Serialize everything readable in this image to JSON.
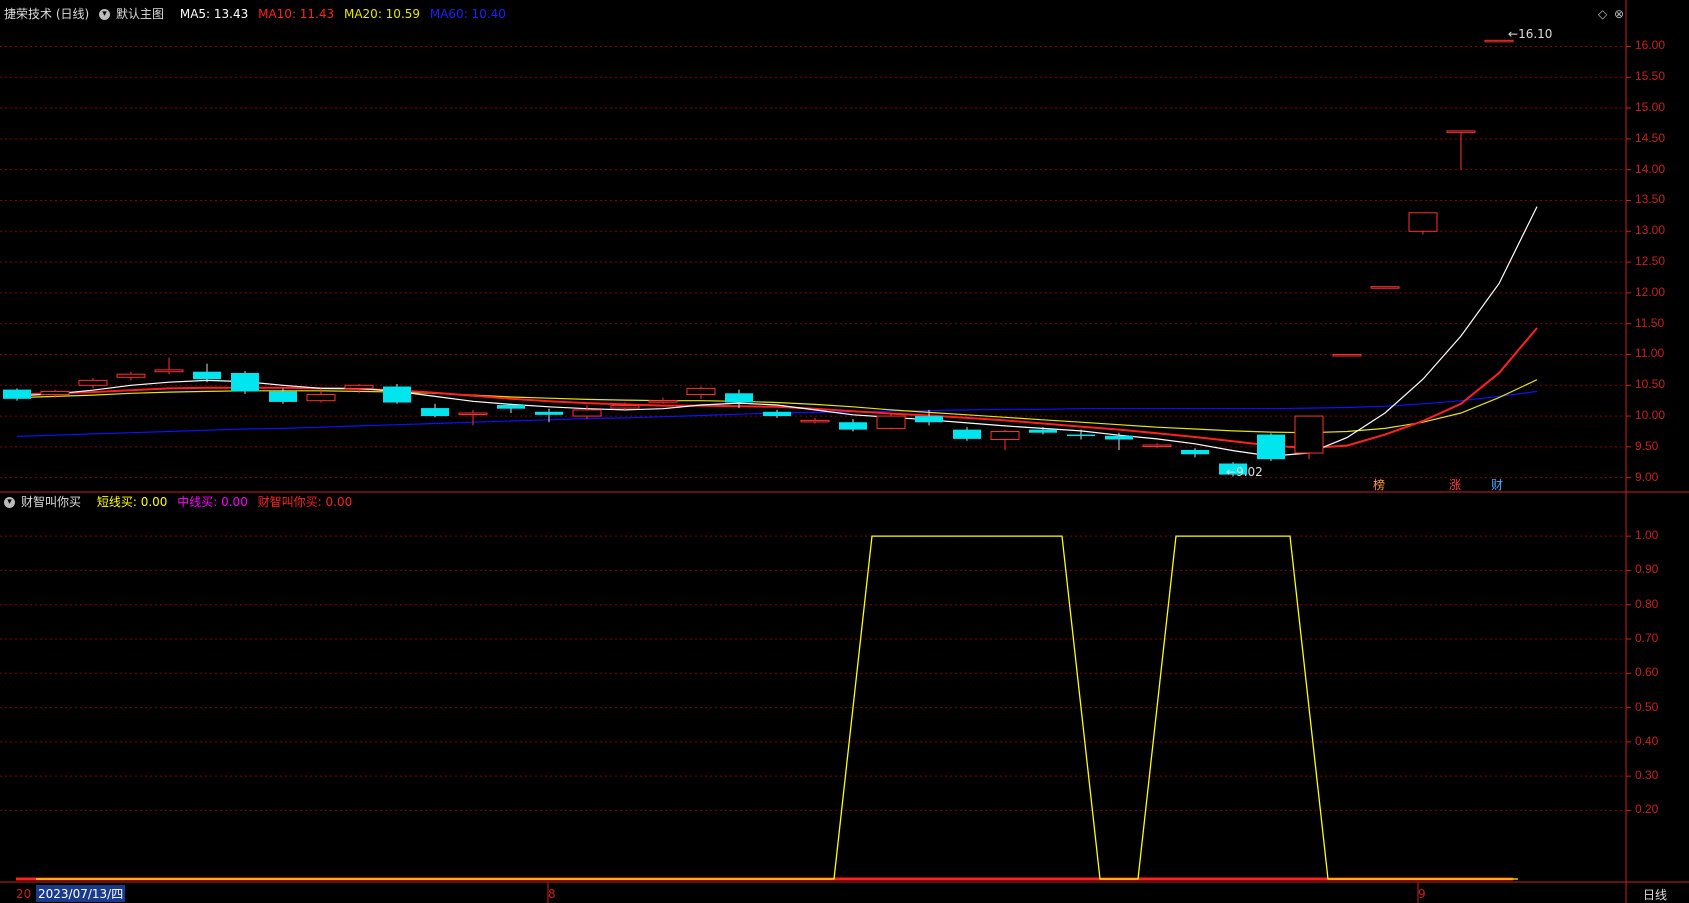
{
  "main_header": {
    "stock_name": "捷荣技术 (日线)",
    "template": "默认主图",
    "ma5": "MA5: 13.43",
    "ma10": "MA10: 11.43",
    "ma20": "MA20: 10.59",
    "ma60": "MA60: 10.40"
  },
  "colors": {
    "bg": "#000000",
    "grid": "#8b0000",
    "axis": "#c8201c",
    "ma5": "#ffffff",
    "ma10": "#ff2020",
    "ma20": "#e6e600",
    "ma60": "#1010ff",
    "up": "#ff3030",
    "down": "#00e5ee",
    "ind_short": "#ffff00",
    "ind_mid": "#ff00ff",
    "ind_call": "#ff2020"
  },
  "price_axis": {
    "ticks": [
      "16.00",
      "15.50",
      "15.00",
      "14.50",
      "14.00",
      "13.50",
      "13.00",
      "12.50",
      "12.00",
      "11.50",
      "11.00",
      "10.50",
      "10.00",
      "9.50",
      "9.00"
    ],
    "high_label": "16.10",
    "low_label": "9.02"
  },
  "indicator_header": {
    "name": "财智叫你买",
    "short_buy": "短线买: 0.00",
    "mid_buy": "中线买: 0.00",
    "call_buy": "财智叫你买: 0.00"
  },
  "indicator_axis": {
    "ticks": [
      "1.00",
      "0.90",
      "0.80",
      "0.70",
      "0.60",
      "0.50",
      "0.40",
      "0.30",
      "0.20"
    ]
  },
  "markers": {
    "cai": "财",
    "bang": "榜",
    "zhang": "涨"
  },
  "time_axis": {
    "left_cut": "20",
    "cursor_date": "2023/07/13/四",
    "month_8": "8",
    "month_9": "9",
    "period_button": "日线"
  },
  "chart_data": {
    "type": "candlestick",
    "title": "捷荣技术 (日线)",
    "ylim": [
      8.8,
      16.3
    ],
    "candles": [
      {
        "o": 10.43,
        "c": 10.28,
        "h": 10.45,
        "l": 10.25
      },
      {
        "o": 10.35,
        "c": 10.4,
        "h": 10.43,
        "l": 10.3
      },
      {
        "o": 10.5,
        "c": 10.58,
        "h": 10.62,
        "l": 10.45
      },
      {
        "o": 10.63,
        "c": 10.68,
        "h": 10.72,
        "l": 10.58
      },
      {
        "o": 10.72,
        "c": 10.75,
        "h": 10.95,
        "l": 10.68
      },
      {
        "o": 10.72,
        "c": 10.6,
        "h": 10.85,
        "l": 10.55
      },
      {
        "o": 10.7,
        "c": 10.4,
        "h": 10.73,
        "l": 10.36
      },
      {
        "o": 10.4,
        "c": 10.23,
        "h": 10.45,
        "l": 10.2
      },
      {
        "o": 10.25,
        "c": 10.35,
        "h": 10.45,
        "l": 10.22
      },
      {
        "o": 10.45,
        "c": 10.5,
        "h": 10.52,
        "l": 10.37
      },
      {
        "o": 10.48,
        "c": 10.22,
        "h": 10.52,
        "l": 10.2
      },
      {
        "o": 10.13,
        "c": 10.0,
        "h": 10.2,
        "l": 9.98
      },
      {
        "o": 10.05,
        "c": 10.05,
        "h": 10.1,
        "l": 9.85
      },
      {
        "o": 10.18,
        "c": 10.12,
        "h": 10.2,
        "l": 10.05
      },
      {
        "o": 10.07,
        "c": 10.02,
        "h": 10.12,
        "l": 9.9
      },
      {
        "o": 10.0,
        "c": 10.1,
        "h": 10.18,
        "l": 9.95
      },
      {
        "o": 10.13,
        "c": 10.17,
        "h": 10.22,
        "l": 10.1
      },
      {
        "o": 10.25,
        "c": 10.25,
        "h": 10.3,
        "l": 10.2
      },
      {
        "o": 10.35,
        "c": 10.45,
        "h": 10.48,
        "l": 10.28
      },
      {
        "o": 10.37,
        "c": 10.22,
        "h": 10.43,
        "l": 10.13
      },
      {
        "o": 10.07,
        "c": 10.0,
        "h": 10.1,
        "l": 9.97
      },
      {
        "o": 9.93,
        "c": 9.93,
        "h": 9.97,
        "l": 9.88
      },
      {
        "o": 9.9,
        "c": 9.78,
        "h": 9.95,
        "l": 9.75
      },
      {
        "o": 9.8,
        "c": 10.0,
        "h": 10.05,
        "l": 9.78
      },
      {
        "o": 10.0,
        "c": 9.9,
        "h": 10.1,
        "l": 9.85
      },
      {
        "o": 9.78,
        "c": 9.63,
        "h": 9.82,
        "l": 9.6
      },
      {
        "o": 9.62,
        "c": 9.75,
        "h": 9.78,
        "l": 9.45
      },
      {
        "o": 9.78,
        "c": 9.73,
        "h": 9.82,
        "l": 9.7
      },
      {
        "o": 9.7,
        "c": 9.68,
        "h": 9.78,
        "l": 9.62
      },
      {
        "o": 9.68,
        "c": 9.62,
        "h": 9.73,
        "l": 9.45
      },
      {
        "o": 9.53,
        "c": 9.53,
        "h": 9.56,
        "l": 9.48
      },
      {
        "o": 9.45,
        "c": 9.38,
        "h": 9.48,
        "l": 9.33
      },
      {
        "o": 9.23,
        "c": 9.05,
        "h": 9.25,
        "l": 9.02
      },
      {
        "o": 9.7,
        "c": 9.3,
        "h": 9.72,
        "l": 9.27
      },
      {
        "o": 9.4,
        "c": 10.0,
        "h": 10.0,
        "l": 9.3
      },
      {
        "o": 11.0,
        "c": 11.0,
        "h": 11.0,
        "l": 11.0
      },
      {
        "o": 12.1,
        "c": 12.1,
        "h": 12.1,
        "l": 12.1
      },
      {
        "o": 13.0,
        "c": 13.3,
        "h": 13.3,
        "l": 12.95
      },
      {
        "o": 14.63,
        "c": 14.63,
        "h": 14.63,
        "l": 14.0
      },
      {
        "o": 16.1,
        "c": 16.1,
        "h": 16.1,
        "l": 16.1
      }
    ],
    "ma5": [
      10.33,
      10.36,
      10.42,
      10.5,
      10.55,
      10.58,
      10.56,
      10.5,
      10.45,
      10.45,
      10.4,
      10.32,
      10.24,
      10.19,
      10.15,
      10.12,
      10.1,
      10.12,
      10.18,
      10.21,
      10.18,
      10.1,
      10.02,
      9.98,
      9.94,
      9.89,
      9.84,
      9.8,
      9.76,
      9.69,
      9.63,
      9.55,
      9.44,
      9.35,
      9.4,
      9.65,
      10.05,
      10.6,
      11.3,
      12.15,
      13.4
    ],
    "ma10": [
      10.35,
      10.37,
      10.39,
      10.42,
      10.45,
      10.46,
      10.46,
      10.46,
      10.45,
      10.44,
      10.42,
      10.38,
      10.33,
      10.28,
      10.24,
      10.21,
      10.19,
      10.17,
      10.17,
      10.16,
      10.15,
      10.12,
      10.08,
      10.04,
      10.01,
      9.97,
      9.93,
      9.88,
      9.83,
      9.78,
      9.72,
      9.66,
      9.59,
      9.52,
      9.48,
      9.52,
      9.7,
      9.92,
      10.2,
      10.7,
      11.43
    ],
    "ma20": [
      10.3,
      10.32,
      10.34,
      10.37,
      10.39,
      10.4,
      10.41,
      10.41,
      10.41,
      10.4,
      10.39,
      10.37,
      10.34,
      10.31,
      10.29,
      10.27,
      10.26,
      10.25,
      10.25,
      10.24,
      10.22,
      10.19,
      10.15,
      10.1,
      10.06,
      10.02,
      9.98,
      9.94,
      9.9,
      9.86,
      9.82,
      9.79,
      9.76,
      9.74,
      9.73,
      9.75,
      9.8,
      9.9,
      10.05,
      10.3,
      10.59
    ],
    "ma60": [
      9.67,
      9.69,
      9.71,
      9.73,
      9.75,
      9.77,
      9.79,
      9.8,
      9.82,
      9.84,
      9.86,
      9.88,
      9.9,
      9.92,
      9.94,
      9.96,
      9.97,
      9.99,
      10.01,
      10.03,
      10.05,
      10.06,
      10.07,
      10.08,
      10.09,
      10.1,
      10.11,
      10.11,
      10.12,
      10.12,
      10.12,
      10.12,
      10.12,
      10.12,
      10.13,
      10.14,
      10.16,
      10.2,
      10.25,
      10.32,
      10.4
    ],
    "indicator": {
      "name": "短线买",
      "ylim": [
        0,
        1.05
      ],
      "values": [
        0,
        0,
        0,
        0,
        0,
        0,
        0,
        0,
        0,
        0,
        0,
        0,
        0,
        0,
        0,
        0,
        0,
        0,
        0,
        0,
        0,
        0,
        1,
        1,
        1,
        1,
        1,
        1,
        0,
        0,
        1,
        1,
        1,
        1,
        0,
        0,
        0,
        0,
        0,
        0
      ]
    }
  }
}
